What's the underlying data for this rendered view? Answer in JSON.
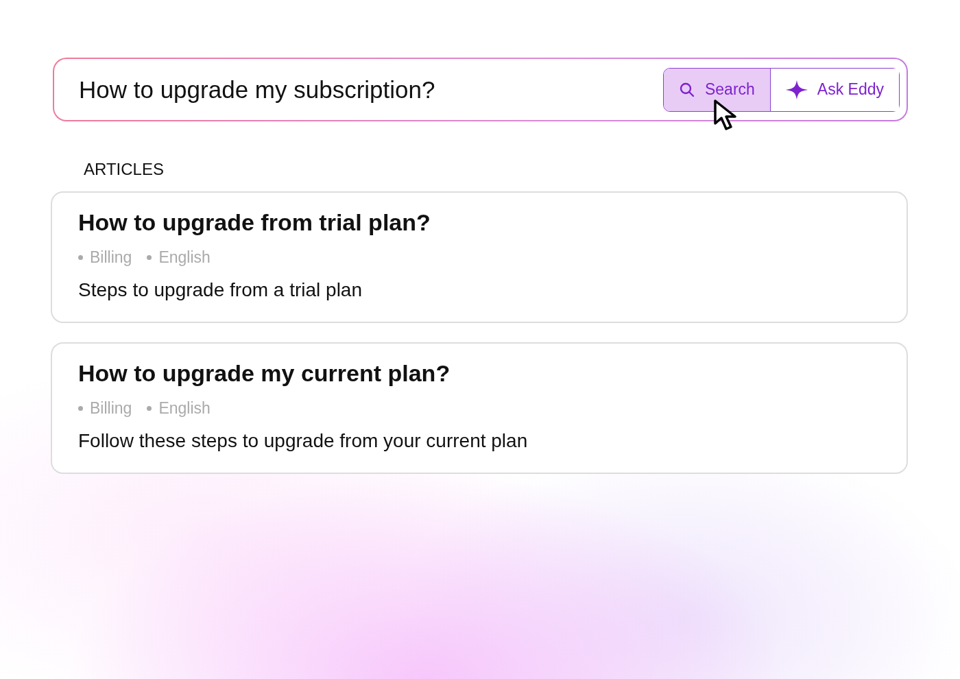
{
  "search": {
    "value": "How to upgrade my subscription?",
    "buttons": [
      {
        "label": "Search",
        "kind": "search",
        "selected": true
      },
      {
        "label": "Ask Eddy",
        "kind": "ask",
        "selected": false
      }
    ]
  },
  "section_title": "ARTICLES",
  "articles": [
    {
      "title": "How to upgrade from trial plan?",
      "tags": [
        "Billing",
        "English"
      ],
      "summary": "Steps to upgrade from a trial plan"
    },
    {
      "title": "How to upgrade my current plan?",
      "tags": [
        "Billing",
        "English"
      ],
      "summary": "Follow these steps to upgrade from your current plan"
    }
  ]
}
